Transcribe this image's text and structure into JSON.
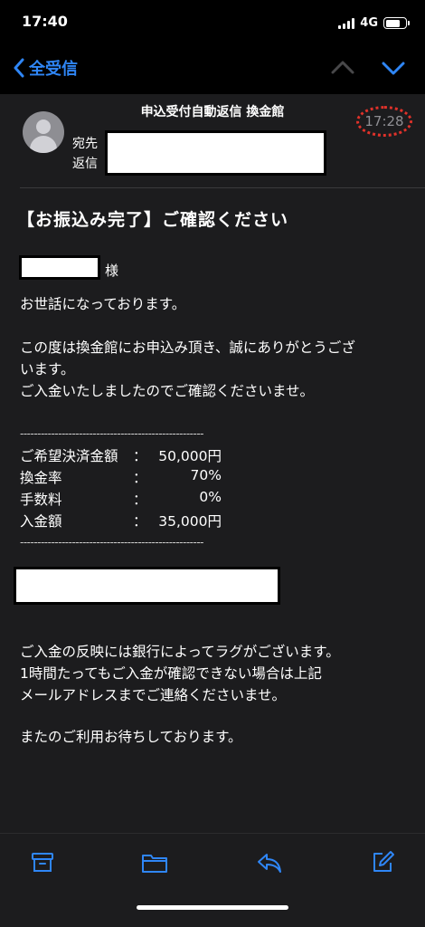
{
  "status_bar": {
    "time": "17:40",
    "network": "4G"
  },
  "nav": {
    "back_label": "全受信"
  },
  "mail": {
    "sender": "申込受付自動返信 換金館",
    "to_label": "宛先",
    "reply_label": "返信",
    "time": "17:28",
    "subject": "【お振込み完了】ご確認ください",
    "honorific": "様",
    "paragraphs": [
      "お世話になっております。",
      "この度は換金館にお申込み頂き、誠にありがとうござ\nいます。\nご入金いたしましたのでご確認くださいませ。",
      "ご入金の反映には銀行によってラグがございます。\n1時間たってもご入金が確認できない場合は上記\nメールアドレスまでご連絡くださいませ。",
      "またのご利用お待ちしております。"
    ],
    "separator": "-----------------------------------------------------",
    "details": [
      {
        "key": "ご希望決済金額",
        "colon": "：",
        "value": "50,000円"
      },
      {
        "key": "換金率",
        "colon": "：",
        "value": "70%"
      },
      {
        "key": "手数料",
        "colon": "：",
        "value": "0%"
      },
      {
        "key": "入金額",
        "colon": "：",
        "value": "35,000円"
      }
    ]
  },
  "toolbar": {
    "icons": [
      "archive-icon",
      "folder-icon",
      "reply-icon",
      "compose-icon"
    ]
  },
  "colors": {
    "accent": "#2f86f6",
    "background": "#1c1c1e",
    "highlight": "#e0322a"
  }
}
